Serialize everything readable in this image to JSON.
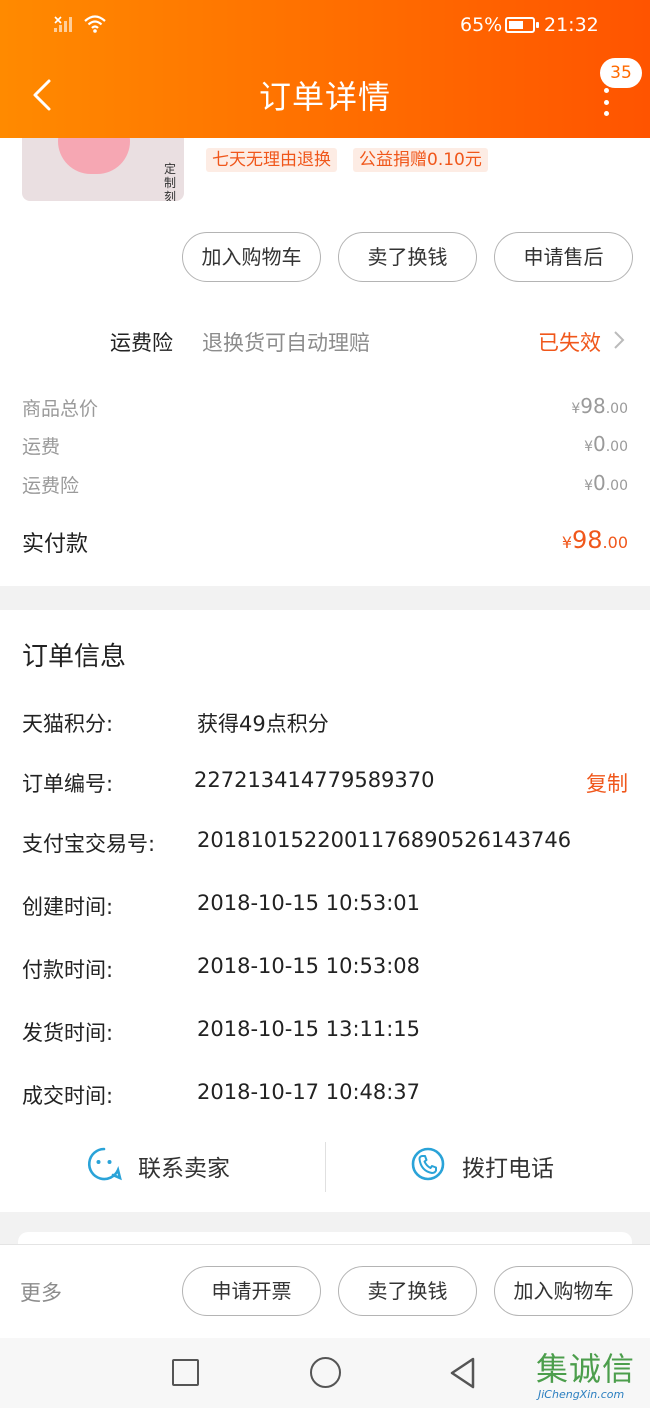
{
  "status_bar": {
    "battery_pct": "65%",
    "battery_level": 0.65,
    "time": "21:32"
  },
  "header": {
    "title": "订单详情",
    "badge": "35"
  },
  "product": {
    "thumb_engrave": "定制刻字",
    "tags": [
      "七天无理由退换",
      "公益捐赠0.10元"
    ]
  },
  "actions": [
    "加入购物车",
    "卖了换钱",
    "申请售后"
  ],
  "insurance": {
    "label": "运费险",
    "desc": "退换货可自动理赔",
    "status": "已失效"
  },
  "prices": [
    {
      "label": "商品总价",
      "yen": "¥",
      "int": "98",
      "dec": ".00"
    },
    {
      "label": "运费",
      "yen": "¥",
      "int": "0",
      "dec": ".00"
    },
    {
      "label": "运费险",
      "yen": "¥",
      "int": "0",
      "dec": ".00"
    }
  ],
  "total": {
    "label": "实付款",
    "yen": "¥",
    "int": "98",
    "dec": ".00"
  },
  "order_info": {
    "title": "订单信息",
    "rows": [
      {
        "key": "天猫积分:",
        "value": "获得49点积分"
      },
      {
        "key": "订单编号:",
        "value": "227213414779589370",
        "action": "复制"
      },
      {
        "key": "支付宝交易号:",
        "value": "2018101522001176890526143746"
      },
      {
        "key": "创建时间:",
        "value": "2018-10-15 10:53:01"
      },
      {
        "key": "付款时间:",
        "value": "2018-10-15 10:53:08"
      },
      {
        "key": "发货时间:",
        "value": "2018-10-15 13:11:15"
      },
      {
        "key": "成交时间:",
        "value": "2018-10-17 10:48:37"
      }
    ]
  },
  "contact": {
    "seller": "联系卖家",
    "phone": "拨打电话"
  },
  "bottom_bar": {
    "more": "更多",
    "buttons": [
      "申请开票",
      "卖了换钱",
      "加入购物车"
    ]
  },
  "watermark": {
    "chars": "集诚信",
    "url": "JiChengXin.com"
  },
  "colors": {
    "accent": "#f0571b",
    "header_start": "#ff8a00",
    "header_end": "#ff5400",
    "icon_blue": "#2aa3d8"
  }
}
